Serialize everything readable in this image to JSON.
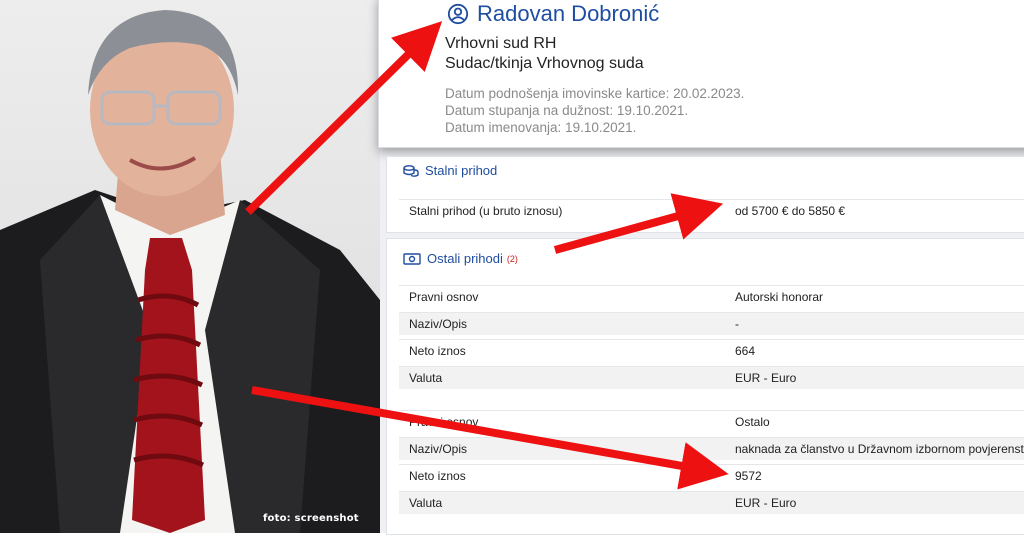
{
  "photo": {
    "credit": "foto: screenshot"
  },
  "profile": {
    "name": "Radovan Dobronić",
    "court": "Vrhovni sud RH",
    "role": "Sudac/tkinja Vrhovnog suda",
    "dates": [
      "Datum podnošenja imovinske kartice: 20.02.2023.",
      "Datum stupanja na dužnost: 19.10.2021.",
      "Datum imenovanja: 19.10.2021."
    ]
  },
  "stalni_prihod": {
    "title": "Stalni prihod",
    "row": {
      "key": "Stalni prihod (u bruto iznosu)",
      "value": "od 5700 € do 5850 €"
    }
  },
  "ostali_prihodi": {
    "title": "Ostali prihodi",
    "count": "(2)",
    "group1": [
      {
        "key": "Pravni osnov",
        "value": "Autorski honorar"
      },
      {
        "key": "Naziv/Opis",
        "value": "-"
      },
      {
        "key": "Neto iznos",
        "value": "664"
      },
      {
        "key": "Valuta",
        "value": "EUR - Euro"
      }
    ],
    "group2": [
      {
        "key": "Pravni osnov",
        "value": "Ostalo"
      },
      {
        "key": "Naziv/Opis",
        "value": "naknada za članstvo u Državnom izbornom povjerenstvu"
      },
      {
        "key": "Neto iznos",
        "value": "9572"
      },
      {
        "key": "Valuta",
        "value": "EUR - Euro"
      }
    ]
  },
  "colors": {
    "accent": "#1f4ea1",
    "arrow": "#ee1111",
    "count": "#d02020"
  }
}
